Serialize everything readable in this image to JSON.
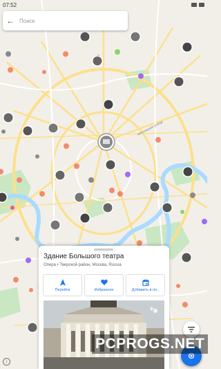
{
  "status_bar": {
    "time": "07:52"
  },
  "search": {
    "placeholder": "Поиск"
  },
  "map": {
    "street_label": "Мясницкая улица"
  },
  "place_card": {
    "title": "Здание Большого театра",
    "subtitle": "Опера • Тверской район, Москва, Russia",
    "actions": [
      {
        "label": "Перейти",
        "icon": "navigate-icon"
      },
      {
        "label": "Избранное",
        "icon": "heart-icon"
      },
      {
        "label": "Добавить в по..",
        "icon": "calendar-icon"
      }
    ]
  },
  "watermark": "PCPROGS.NET",
  "colors": {
    "accent": "#1a73e8",
    "water": "#aadaff",
    "park": "#c9e7c3",
    "road": "#fce08a",
    "pin_orange": "#f28b6b",
    "pin_purple": "#9b6cf2",
    "pin_green": "#8bd36b",
    "pin_pink": "#e8599b"
  }
}
